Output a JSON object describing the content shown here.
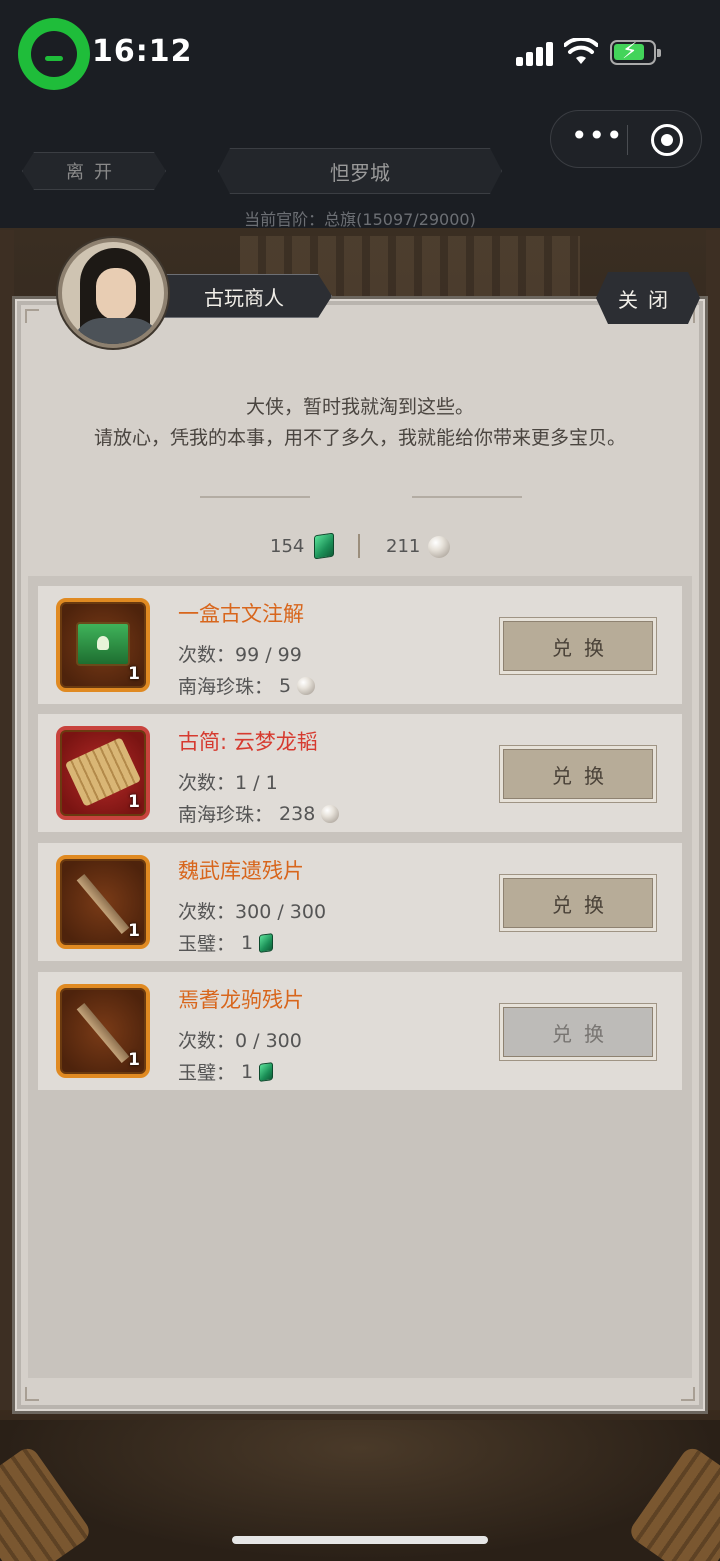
{
  "status_bar": {
    "time": "16:12",
    "app_logo_icon": "chat-bubble-logo-icon",
    "signal_icon": "cellular-signal-icon",
    "wifi_icon": "wifi-icon",
    "battery_icon": "battery-charging-icon"
  },
  "capsule": {
    "more_label": "•••",
    "more_icon": "more-dots-icon",
    "close_icon": "target-close-icon"
  },
  "nav": {
    "leave_label": "离开",
    "city_name": "怛罗城",
    "rank_text": "当前官阶：总旗(15097/29000)"
  },
  "npc": {
    "name": "古玩商人",
    "avatar_icon": "merchant-avatar-icon",
    "close_label": "关闭",
    "dialogue_line1": "大侠，暂时我就淘到这些。",
    "dialogue_line2": "请放心，凭我的本事，用不了多久，我就能给你带来更多宝贝。"
  },
  "currency": {
    "jade_amount": "154",
    "jade_icon": "jade-icon",
    "pearl_amount": "211",
    "pearl_icon": "pearl-icon"
  },
  "items": [
    {
      "name": "一盒古文注解",
      "count_badge": "1",
      "icon": "green-chest-icon",
      "uses_label": "次数：",
      "uses": "99 / 99",
      "cost_label": "南海珍珠：",
      "cost": "5",
      "cost_icon": "pearl-icon",
      "button_label": "兑换"
    },
    {
      "name": "古简: 云梦龙韬",
      "count_badge": "1",
      "icon": "bamboo-scroll-icon",
      "uses_label": "次数：",
      "uses": "1 / 1",
      "cost_label": "南海珍珠：",
      "cost": "238",
      "cost_icon": "pearl-icon",
      "button_label": "兑换"
    },
    {
      "name": "魏武库遗残片",
      "count_badge": "1",
      "icon": "bamboo-slip-icon",
      "uses_label": "次数：",
      "uses": "300 / 300",
      "cost_label": "玉璧：",
      "cost": "1",
      "cost_icon": "jade-icon",
      "button_label": "兑换"
    },
    {
      "name": "焉耆龙驹残片",
      "count_badge": "1",
      "icon": "bamboo-slip-icon",
      "uses_label": "次数：",
      "uses": "0 / 300",
      "cost_label": "玉璧：",
      "cost": "1",
      "cost_icon": "jade-icon",
      "button_label": "兑换"
    }
  ]
}
